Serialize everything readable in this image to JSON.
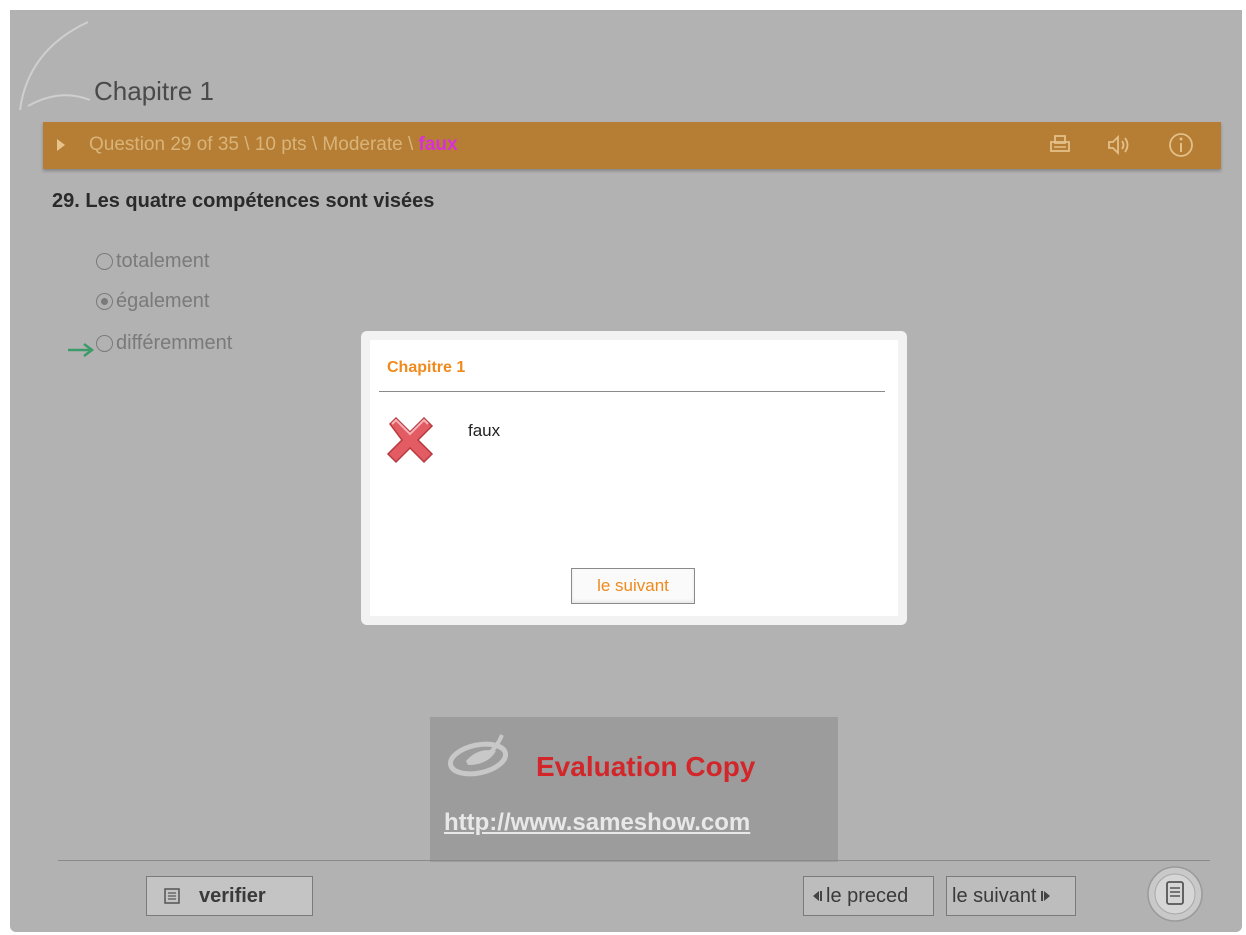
{
  "header": {
    "chapter_title": "Chapitre 1"
  },
  "question_bar": {
    "prefix": "Question 29 of 35 \\ 10 pts \\ Moderate \\ ",
    "status": "faux",
    "icons": [
      "print-icon",
      "speaker-icon",
      "info-icon"
    ]
  },
  "question": {
    "text": "29.  Les quatre compétences sont visées",
    "options": [
      {
        "label": "totalement",
        "selected": false
      },
      {
        "label": "également",
        "selected": true
      },
      {
        "label": "différemment",
        "selected": false,
        "correct": true
      }
    ]
  },
  "dialog": {
    "title": "Chapitre 1",
    "message": "faux",
    "button_label": "le suivant"
  },
  "watermark": {
    "title": "Evaluation Copy",
    "url": "http://www.sameshow.com"
  },
  "footer": {
    "verify_label": "verifier",
    "prev_label": "le preced",
    "next_label": "le suivant"
  },
  "colors": {
    "bar": "#b57e34",
    "status": "#d92fd9",
    "dialog_accent": "#f08a1c",
    "watermark_red": "#d2262a"
  }
}
